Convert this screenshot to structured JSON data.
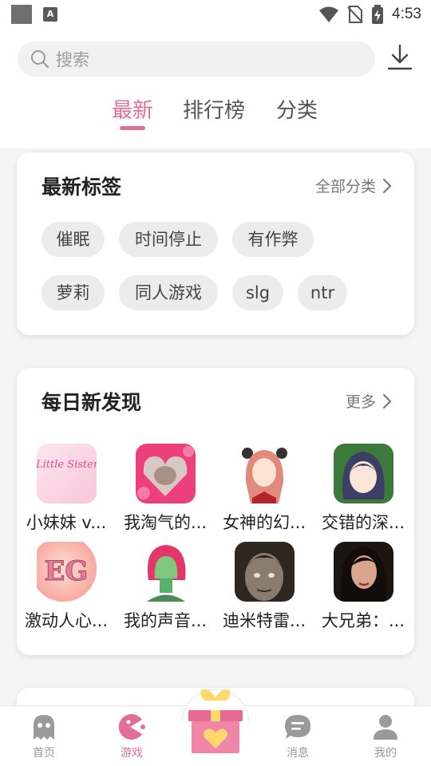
{
  "status_bar": {
    "time": "4:53",
    "notification_icon": "a-icon",
    "icons": [
      "wifi-icon",
      "no-sim-icon",
      "battery-charging-icon"
    ]
  },
  "search": {
    "placeholder": "搜索",
    "icon": "search-icon"
  },
  "download_icon": "download-icon",
  "tabs": [
    {
      "label": "最新",
      "active": true
    },
    {
      "label": "排行榜",
      "active": false
    },
    {
      "label": "分类",
      "active": false
    }
  ],
  "latest_tags": {
    "title": "最新标签",
    "link_label": "全部分类",
    "tags": [
      "催眠",
      "时间停止",
      "有作弊",
      "萝莉",
      "同人游戏",
      "slg",
      "ntr"
    ]
  },
  "daily": {
    "title": "每日新发现",
    "link_label": "更多",
    "games": [
      {
        "name": "小妹妹 v..."
      },
      {
        "name": "我淘气的..."
      },
      {
        "name": "女神的幻..."
      },
      {
        "name": "交错的深..."
      },
      {
        "name": "激动人心..."
      },
      {
        "name": "我的声音..."
      },
      {
        "name": "迪米特雷..."
      },
      {
        "name": "大兄弟：..."
      }
    ],
    "thumb_1_text": "Little Sister",
    "thumb_5_text": "EG"
  },
  "bottom_nav": [
    {
      "label": "首页",
      "icon": "ghost-icon",
      "active": false
    },
    {
      "label": "游戏",
      "icon": "pacman-icon",
      "active": true
    },
    {
      "label": "",
      "icon": "gift-icon",
      "active": false
    },
    {
      "label": "消息",
      "icon": "message-icon",
      "active": false
    },
    {
      "label": "我的",
      "icon": "user-icon",
      "active": false
    }
  ],
  "colors": {
    "accent": "#e26d98",
    "tag_bg": "#ececec",
    "inactive": "#999999"
  }
}
